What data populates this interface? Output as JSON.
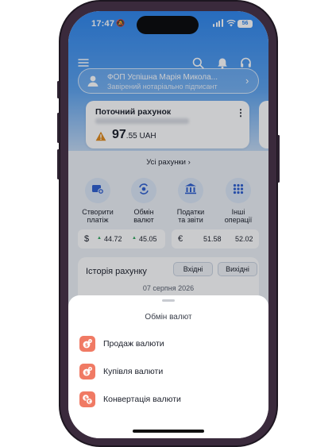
{
  "status_bar": {
    "time": "17:47",
    "battery": "56"
  },
  "profile": {
    "name": "ФОП Успішна Марія Микола...",
    "subtitle": "Завірений нотаріально підписант"
  },
  "account_card": {
    "title": "Поточний рахунок",
    "balance_int": "97",
    "balance_frac": ".55 UAH"
  },
  "all_accounts": "Усі рахунки",
  "operations": [
    {
      "label_1": "Створити",
      "label_2": "платіж",
      "icon": "create-payment-icon"
    },
    {
      "label_1": "Обмін",
      "label_2": "валют",
      "icon": "currency-exchange-icon"
    },
    {
      "label_1": "Податки",
      "label_2": "та звіти",
      "icon": "taxes-icon"
    },
    {
      "label_1": "Інші",
      "label_2": "операції",
      "icon": "grid-icon"
    }
  ],
  "rates": {
    "usd": {
      "symbol": "$",
      "buy": "44.72",
      "sell": "45.05"
    },
    "eur": {
      "symbol": "€",
      "buy": "51.58",
      "sell": "52.02"
    }
  },
  "history": {
    "title": "Історія рахунку",
    "tab_incoming": "Вхідні",
    "tab_outgoing": "Вихідні",
    "date": "07 серпня 2026"
  },
  "sheet": {
    "title": "Обмін валют",
    "items": [
      {
        "label": "Продаж валюти",
        "icon": "sell-currency-icon"
      },
      {
        "label": "Купівля валюти",
        "icon": "buy-currency-icon"
      },
      {
        "label": "Конвертація валюти",
        "icon": "convert-currency-icon"
      }
    ]
  },
  "colors": {
    "primary": "#2f86ec",
    "accent": "#f07a64",
    "warning": "#e08a1c",
    "rate_up": "#2ea65a"
  }
}
